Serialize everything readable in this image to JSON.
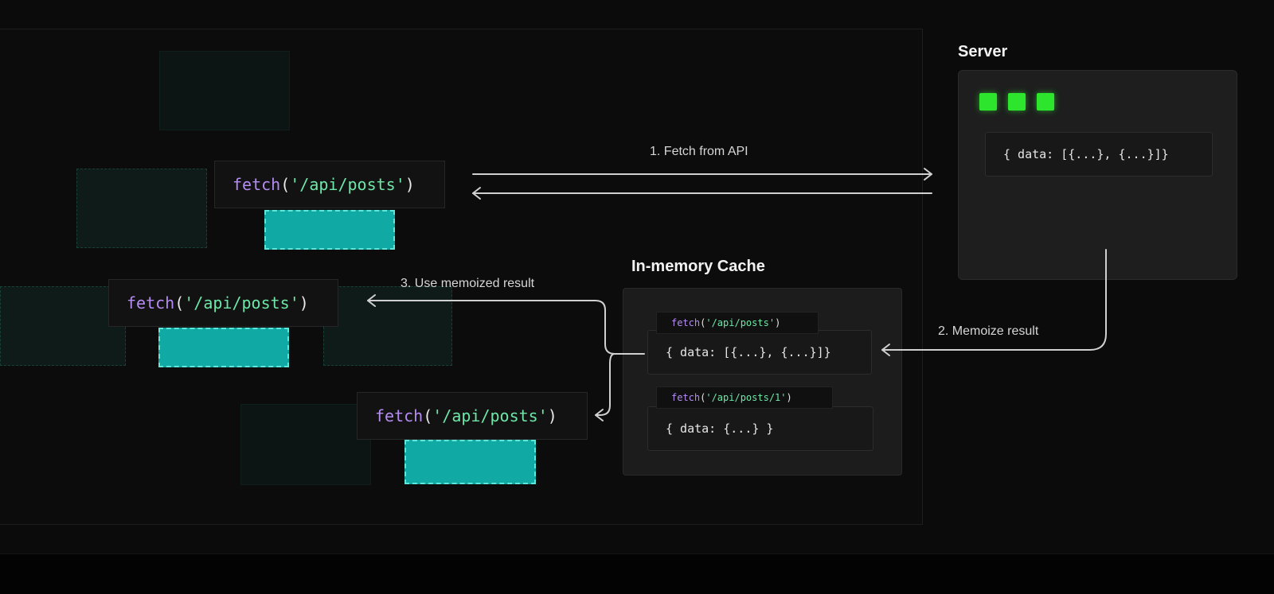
{
  "server": {
    "title": "Server",
    "response": "{ data: [{...}, {...}]}"
  },
  "cache": {
    "title": "In-memory Cache",
    "entries": [
      {
        "key_fn": "fetch",
        "key_open": "(",
        "key_arg": "'/api/posts'",
        "key_close": ")",
        "value": "{ data: [{...}, {...}]}"
      },
      {
        "key_fn": "fetch",
        "key_open": "(",
        "key_arg": "'/api/posts/1'",
        "key_close": ")",
        "value": "{ data: {...} }"
      }
    ]
  },
  "requests": [
    {
      "fn": "fetch",
      "open": "(",
      "arg": "'/api/posts'",
      "close": ")"
    },
    {
      "fn": "fetch",
      "open": "(",
      "arg": "'/api/posts'",
      "close": ")"
    },
    {
      "fn": "fetch",
      "open": "(",
      "arg": "'/api/posts'",
      "close": ")"
    }
  ],
  "steps": {
    "fetch_from_api": "1. Fetch from API",
    "memoize_result": "2. Memoize result",
    "use_memoized": "3. Use memoized result"
  },
  "colors": {
    "keyword": "#b48cf2",
    "string": "#6ee7a8",
    "teal": "#10a9a3",
    "server_dot": "#2ee52e"
  }
}
